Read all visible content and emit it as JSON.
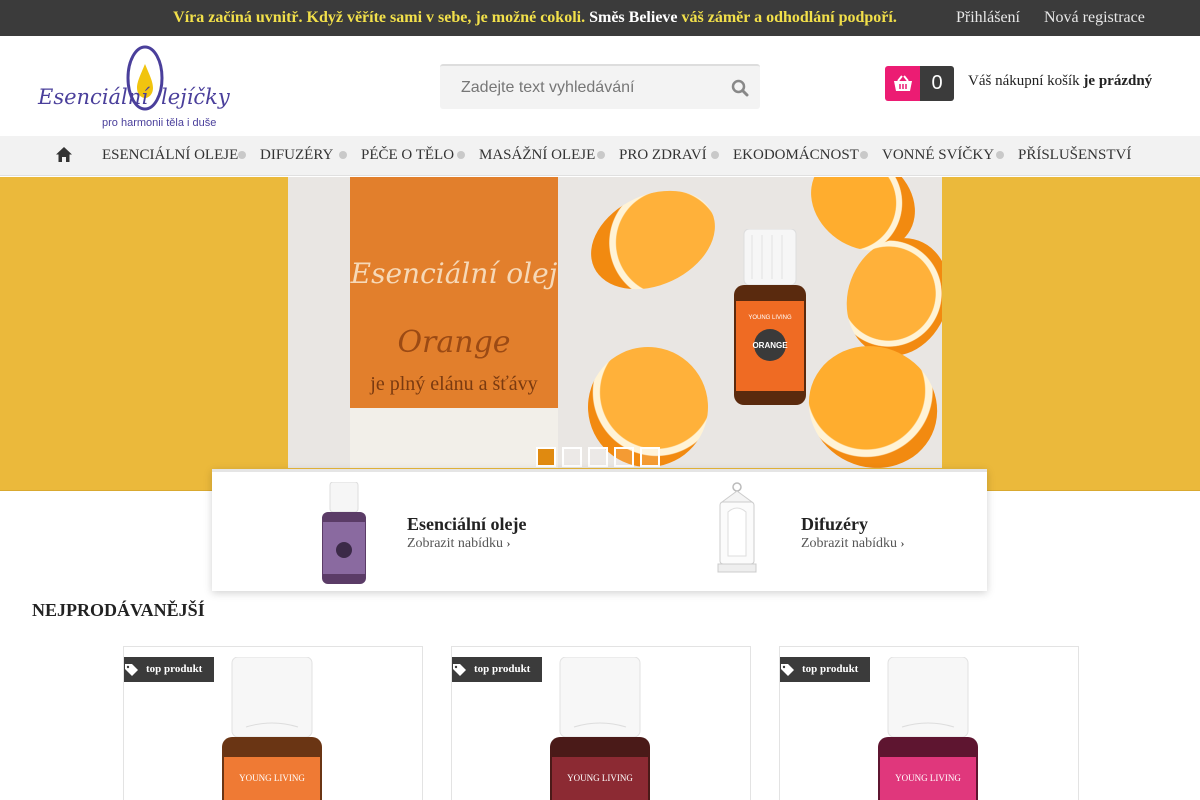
{
  "topbar": {
    "promo_part1": "Víra začíná uvnitř. Když věříte sami v sebe, je možné cokoli.",
    "promo_highlight": "Směs Believe",
    "promo_part2": "váš záměr a odhodlání podpoří.",
    "login": "Přihlášení",
    "register": "Nová registrace"
  },
  "header": {
    "logo_text": "Esenciální Olejíčky",
    "logo_tagline": "pro harmonii těla i duše",
    "search_placeholder": "Zadejte text vyhledávání",
    "cart_count": "0",
    "cart_text": "Váš nákupní košík",
    "cart_status": "je prázdný"
  },
  "nav": {
    "items": [
      "Esenciální oleje",
      "Difuzéry",
      "Péče o tělo",
      "Masážní oleje",
      "Pro zdraví",
      "Ekodomácnost",
      "Vonné svíčky",
      "Příslušenství"
    ]
  },
  "banner": {
    "line1": "Esenciální olej",
    "line2": "Orange",
    "line3": "je plný elánu a šťávy",
    "bottle_label": "ORANGE",
    "bottle_brand": "YOUNG LIVING",
    "slides_count": 5,
    "active_slide": 1
  },
  "categories": [
    {
      "title": "Esenciální oleje",
      "link": "Zobrazit nabídku"
    },
    {
      "title": "Difuzéry",
      "link": "Zobrazit nabídku"
    }
  ],
  "section": {
    "title": "Nejprodávanější"
  },
  "products": [
    {
      "badge": "top produkt",
      "color": "#ef7a34"
    },
    {
      "badge": "top produkt",
      "color": "#8c2a33"
    },
    {
      "badge": "top produkt",
      "color": "#e0377c"
    }
  ],
  "colors": {
    "accent_pink": "#ec1c73",
    "dark": "#3b3b3b",
    "banner_yellow": "#ebb93b",
    "promo_yellow": "#f2e04a"
  }
}
